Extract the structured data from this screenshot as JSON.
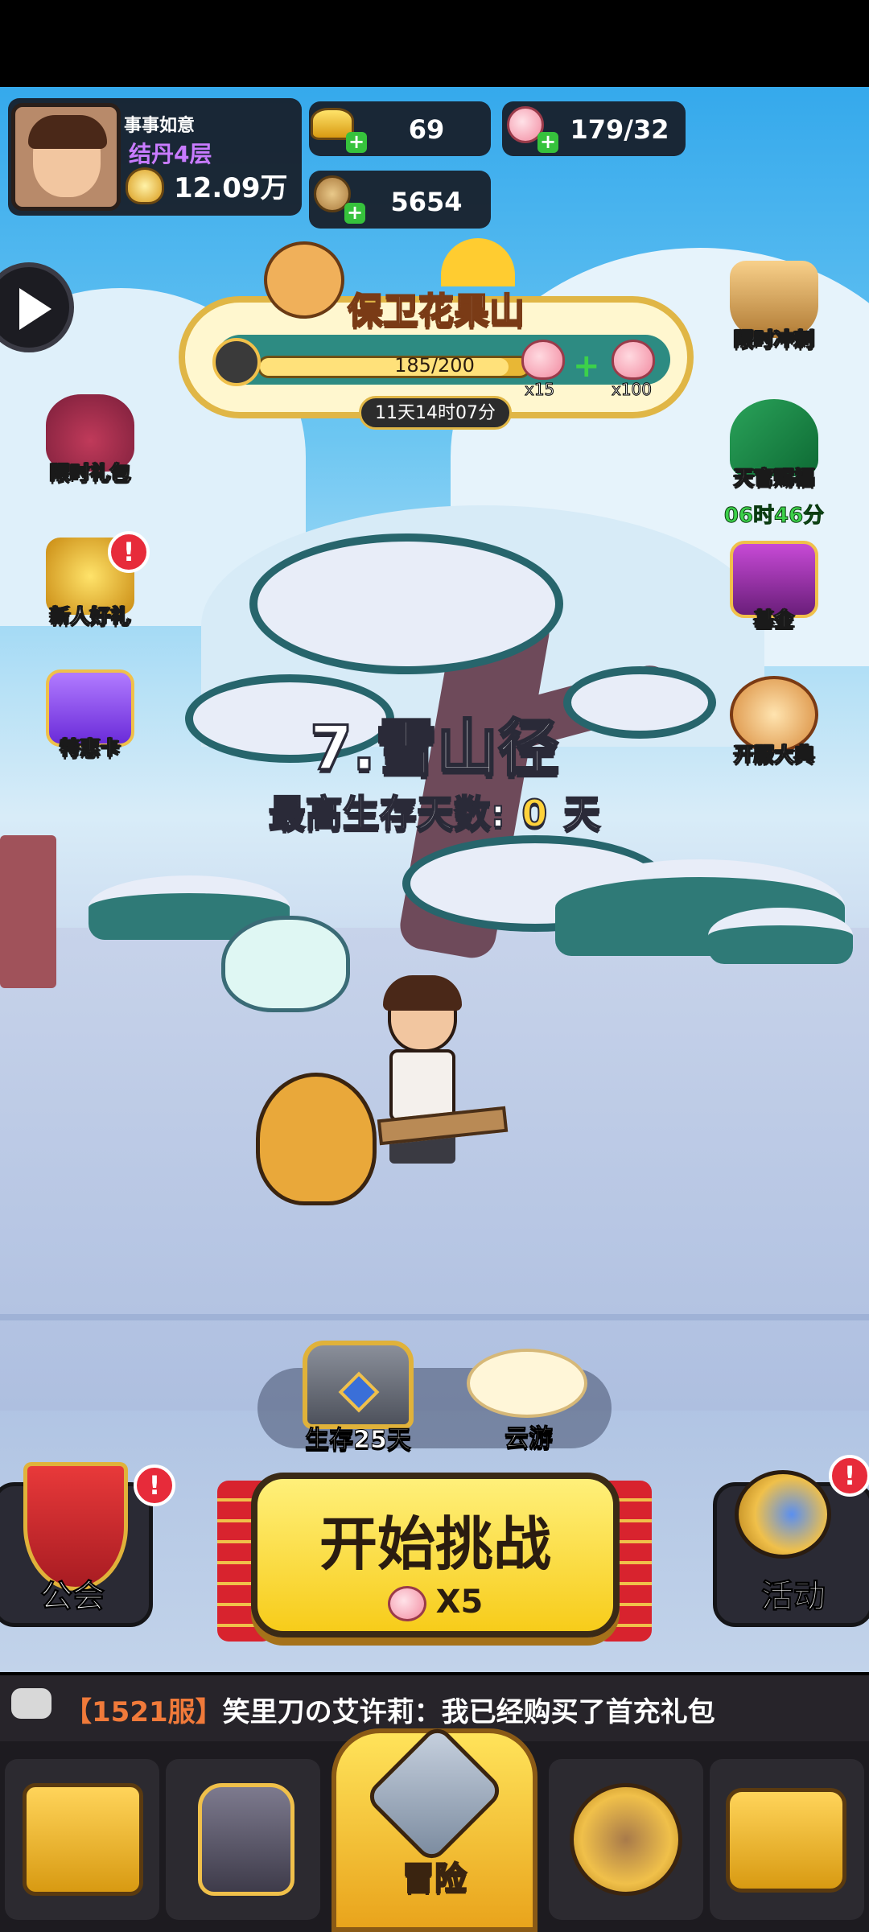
{
  "player": {
    "name": "事事如意",
    "realm": "结丹4层",
    "power": "12.09万"
  },
  "currency": {
    "gold": "69",
    "peach": "179/32",
    "coin": "5654"
  },
  "event": {
    "title": "保卫花果山",
    "progress_text": "185/200",
    "progress": 0.925,
    "reward1_qty": "x15",
    "reward2_qty": "x100",
    "timer": "11天14时07分"
  },
  "left_buttons": [
    {
      "label": "限时礼包"
    },
    {
      "label": "新人好礼"
    },
    {
      "label": "特惠卡"
    }
  ],
  "right_buttons": [
    {
      "label": "限时冲刺"
    },
    {
      "label": "天官赐福",
      "timer": "06时46分"
    },
    {
      "label": "基金"
    },
    {
      "label": "开服大典"
    }
  ],
  "badge_symbol": "!",
  "level": {
    "title": "7.雪山径",
    "survival_label": "最高生存天数:",
    "survival_days": "0",
    "survival_unit": "天"
  },
  "mid": {
    "chest_label": "生存25天",
    "cloud_label": "云游"
  },
  "start": {
    "label": "开始挑战",
    "cost": "X5"
  },
  "guild": {
    "label": "公会"
  },
  "activity": {
    "label": "活动"
  },
  "chat": {
    "server": "【1521服】",
    "message": "笑里刀の艾许莉：我已经购买了首充礼包"
  },
  "nav": {
    "active_label": "冒险"
  },
  "colors": {
    "accent_gold": "#ffd23a",
    "timer_green": "#3cd14a",
    "badge_red": "#e72b3a",
    "server_orange": "#f07a3a"
  }
}
